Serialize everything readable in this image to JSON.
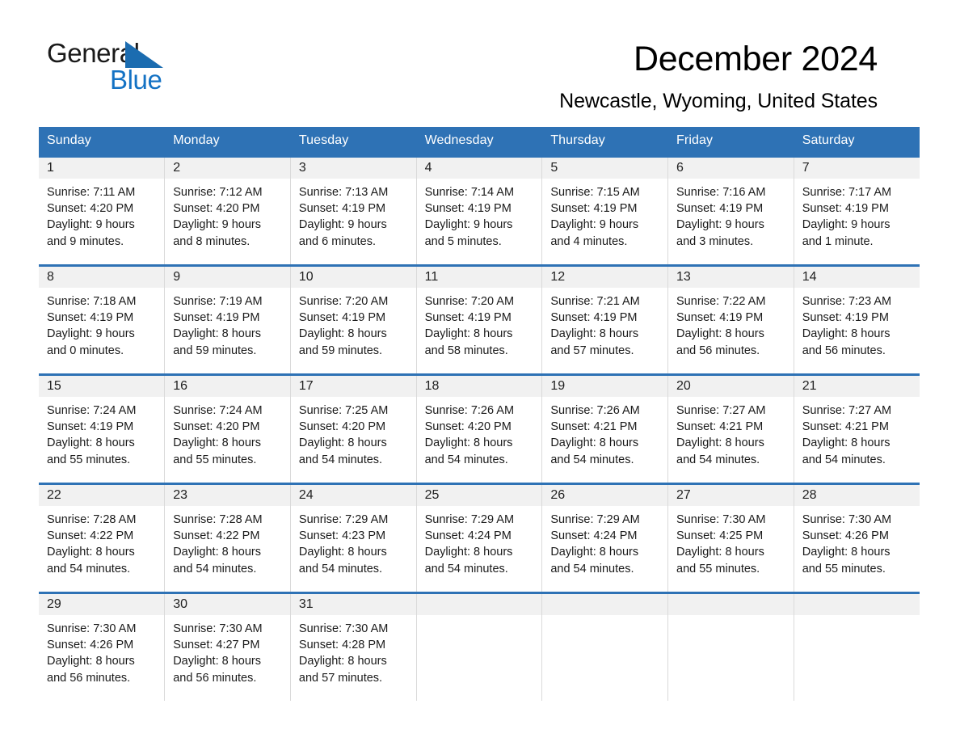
{
  "brand": {
    "name_part1": "General",
    "name_part2": "Blue",
    "logo_icon": "triangle-logo-icon",
    "accent_color": "#1472c4",
    "triangle_color": "#1b6cb0"
  },
  "header": {
    "title": "December 2024",
    "subtitle": "Newcastle, Wyoming, United States"
  },
  "theme": {
    "header_blue": "#2e72b5",
    "daynum_band": "#f1f1f1",
    "cell_divider": "#dadada"
  },
  "calendar": {
    "weekday_headers": [
      "Sunday",
      "Monday",
      "Tuesday",
      "Wednesday",
      "Thursday",
      "Friday",
      "Saturday"
    ],
    "weeks": [
      [
        {
          "day": "1",
          "sunrise": "Sunrise: 7:11 AM",
          "sunset": "Sunset: 4:20 PM",
          "daylight_line1": "Daylight: 9 hours",
          "daylight_line2": "and 9 minutes."
        },
        {
          "day": "2",
          "sunrise": "Sunrise: 7:12 AM",
          "sunset": "Sunset: 4:20 PM",
          "daylight_line1": "Daylight: 9 hours",
          "daylight_line2": "and 8 minutes."
        },
        {
          "day": "3",
          "sunrise": "Sunrise: 7:13 AM",
          "sunset": "Sunset: 4:19 PM",
          "daylight_line1": "Daylight: 9 hours",
          "daylight_line2": "and 6 minutes."
        },
        {
          "day": "4",
          "sunrise": "Sunrise: 7:14 AM",
          "sunset": "Sunset: 4:19 PM",
          "daylight_line1": "Daylight: 9 hours",
          "daylight_line2": "and 5 minutes."
        },
        {
          "day": "5",
          "sunrise": "Sunrise: 7:15 AM",
          "sunset": "Sunset: 4:19 PM",
          "daylight_line1": "Daylight: 9 hours",
          "daylight_line2": "and 4 minutes."
        },
        {
          "day": "6",
          "sunrise": "Sunrise: 7:16 AM",
          "sunset": "Sunset: 4:19 PM",
          "daylight_line1": "Daylight: 9 hours",
          "daylight_line2": "and 3 minutes."
        },
        {
          "day": "7",
          "sunrise": "Sunrise: 7:17 AM",
          "sunset": "Sunset: 4:19 PM",
          "daylight_line1": "Daylight: 9 hours",
          "daylight_line2": "and 1 minute."
        }
      ],
      [
        {
          "day": "8",
          "sunrise": "Sunrise: 7:18 AM",
          "sunset": "Sunset: 4:19 PM",
          "daylight_line1": "Daylight: 9 hours",
          "daylight_line2": "and 0 minutes."
        },
        {
          "day": "9",
          "sunrise": "Sunrise: 7:19 AM",
          "sunset": "Sunset: 4:19 PM",
          "daylight_line1": "Daylight: 8 hours",
          "daylight_line2": "and 59 minutes."
        },
        {
          "day": "10",
          "sunrise": "Sunrise: 7:20 AM",
          "sunset": "Sunset: 4:19 PM",
          "daylight_line1": "Daylight: 8 hours",
          "daylight_line2": "and 59 minutes."
        },
        {
          "day": "11",
          "sunrise": "Sunrise: 7:20 AM",
          "sunset": "Sunset: 4:19 PM",
          "daylight_line1": "Daylight: 8 hours",
          "daylight_line2": "and 58 minutes."
        },
        {
          "day": "12",
          "sunrise": "Sunrise: 7:21 AM",
          "sunset": "Sunset: 4:19 PM",
          "daylight_line1": "Daylight: 8 hours",
          "daylight_line2": "and 57 minutes."
        },
        {
          "day": "13",
          "sunrise": "Sunrise: 7:22 AM",
          "sunset": "Sunset: 4:19 PM",
          "daylight_line1": "Daylight: 8 hours",
          "daylight_line2": "and 56 minutes."
        },
        {
          "day": "14",
          "sunrise": "Sunrise: 7:23 AM",
          "sunset": "Sunset: 4:19 PM",
          "daylight_line1": "Daylight: 8 hours",
          "daylight_line2": "and 56 minutes."
        }
      ],
      [
        {
          "day": "15",
          "sunrise": "Sunrise: 7:24 AM",
          "sunset": "Sunset: 4:19 PM",
          "daylight_line1": "Daylight: 8 hours",
          "daylight_line2": "and 55 minutes."
        },
        {
          "day": "16",
          "sunrise": "Sunrise: 7:24 AM",
          "sunset": "Sunset: 4:20 PM",
          "daylight_line1": "Daylight: 8 hours",
          "daylight_line2": "and 55 minutes."
        },
        {
          "day": "17",
          "sunrise": "Sunrise: 7:25 AM",
          "sunset": "Sunset: 4:20 PM",
          "daylight_line1": "Daylight: 8 hours",
          "daylight_line2": "and 54 minutes."
        },
        {
          "day": "18",
          "sunrise": "Sunrise: 7:26 AM",
          "sunset": "Sunset: 4:20 PM",
          "daylight_line1": "Daylight: 8 hours",
          "daylight_line2": "and 54 minutes."
        },
        {
          "day": "19",
          "sunrise": "Sunrise: 7:26 AM",
          "sunset": "Sunset: 4:21 PM",
          "daylight_line1": "Daylight: 8 hours",
          "daylight_line2": "and 54 minutes."
        },
        {
          "day": "20",
          "sunrise": "Sunrise: 7:27 AM",
          "sunset": "Sunset: 4:21 PM",
          "daylight_line1": "Daylight: 8 hours",
          "daylight_line2": "and 54 minutes."
        },
        {
          "day": "21",
          "sunrise": "Sunrise: 7:27 AM",
          "sunset": "Sunset: 4:21 PM",
          "daylight_line1": "Daylight: 8 hours",
          "daylight_line2": "and 54 minutes."
        }
      ],
      [
        {
          "day": "22",
          "sunrise": "Sunrise: 7:28 AM",
          "sunset": "Sunset: 4:22 PM",
          "daylight_line1": "Daylight: 8 hours",
          "daylight_line2": "and 54 minutes."
        },
        {
          "day": "23",
          "sunrise": "Sunrise: 7:28 AM",
          "sunset": "Sunset: 4:22 PM",
          "daylight_line1": "Daylight: 8 hours",
          "daylight_line2": "and 54 minutes."
        },
        {
          "day": "24",
          "sunrise": "Sunrise: 7:29 AM",
          "sunset": "Sunset: 4:23 PM",
          "daylight_line1": "Daylight: 8 hours",
          "daylight_line2": "and 54 minutes."
        },
        {
          "day": "25",
          "sunrise": "Sunrise: 7:29 AM",
          "sunset": "Sunset: 4:24 PM",
          "daylight_line1": "Daylight: 8 hours",
          "daylight_line2": "and 54 minutes."
        },
        {
          "day": "26",
          "sunrise": "Sunrise: 7:29 AM",
          "sunset": "Sunset: 4:24 PM",
          "daylight_line1": "Daylight: 8 hours",
          "daylight_line2": "and 54 minutes."
        },
        {
          "day": "27",
          "sunrise": "Sunrise: 7:30 AM",
          "sunset": "Sunset: 4:25 PM",
          "daylight_line1": "Daylight: 8 hours",
          "daylight_line2": "and 55 minutes."
        },
        {
          "day": "28",
          "sunrise": "Sunrise: 7:30 AM",
          "sunset": "Sunset: 4:26 PM",
          "daylight_line1": "Daylight: 8 hours",
          "daylight_line2": "and 55 minutes."
        }
      ],
      [
        {
          "day": "29",
          "sunrise": "Sunrise: 7:30 AM",
          "sunset": "Sunset: 4:26 PM",
          "daylight_line1": "Daylight: 8 hours",
          "daylight_line2": "and 56 minutes."
        },
        {
          "day": "30",
          "sunrise": "Sunrise: 7:30 AM",
          "sunset": "Sunset: 4:27 PM",
          "daylight_line1": "Daylight: 8 hours",
          "daylight_line2": "and 56 minutes."
        },
        {
          "day": "31",
          "sunrise": "Sunrise: 7:30 AM",
          "sunset": "Sunset: 4:28 PM",
          "daylight_line1": "Daylight: 8 hours",
          "daylight_line2": "and 57 minutes."
        },
        {
          "day": "",
          "sunrise": "",
          "sunset": "",
          "daylight_line1": "",
          "daylight_line2": ""
        },
        {
          "day": "",
          "sunrise": "",
          "sunset": "",
          "daylight_line1": "",
          "daylight_line2": ""
        },
        {
          "day": "",
          "sunrise": "",
          "sunset": "",
          "daylight_line1": "",
          "daylight_line2": ""
        },
        {
          "day": "",
          "sunrise": "",
          "sunset": "",
          "daylight_line1": "",
          "daylight_line2": ""
        }
      ]
    ]
  }
}
